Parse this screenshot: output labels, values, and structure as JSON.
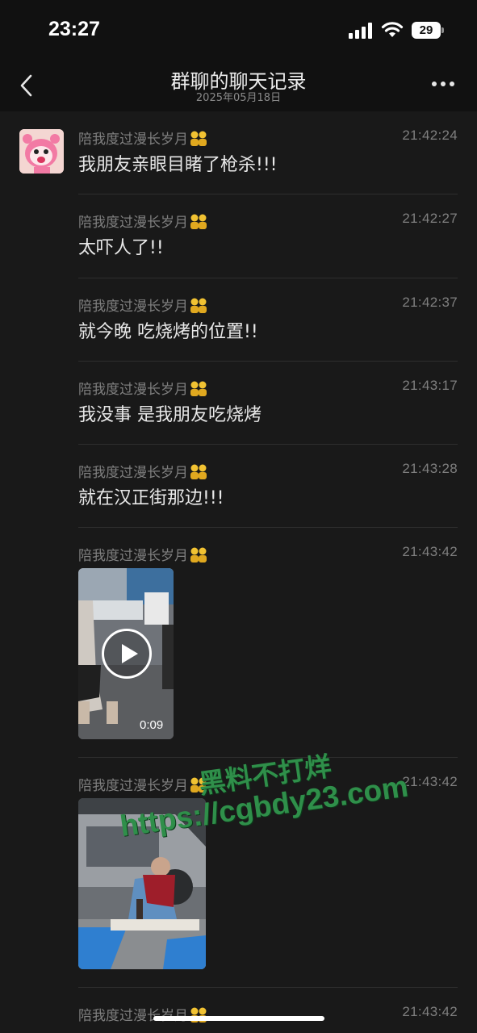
{
  "status_bar": {
    "time": "23:27",
    "battery": "29"
  },
  "nav": {
    "title": "群聊的聊天记录",
    "date": "2025年05月18日"
  },
  "messages": [
    {
      "sender": "陪我度过漫长岁月",
      "time": "21:42:24",
      "text": "我朋友亲眼目睹了枪杀!!!"
    },
    {
      "sender": "陪我度过漫长岁月",
      "time": "21:42:27",
      "text": "太吓人了!!"
    },
    {
      "sender": "陪我度过漫长岁月",
      "time": "21:42:37",
      "text": "就今晚 吃烧烤的位置!!"
    },
    {
      "sender": "陪我度过漫长岁月",
      "time": "21:43:17",
      "text": "我没事 是我朋友吃烧烤"
    },
    {
      "sender": "陪我度过漫长岁月",
      "time": "21:43:28",
      "text": "就在汉正街那边!!!"
    },
    {
      "sender": "陪我度过漫长岁月",
      "time": "21:43:42",
      "video_duration": "0:09"
    },
    {
      "sender": "陪我度过漫长岁月",
      "time": "21:43:42"
    },
    {
      "sender": "陪我度过漫长岁月",
      "time": "21:43:42"
    }
  ],
  "watermark": {
    "line1": "黑料不打烊",
    "line2": "https://cgbdy23.com"
  }
}
